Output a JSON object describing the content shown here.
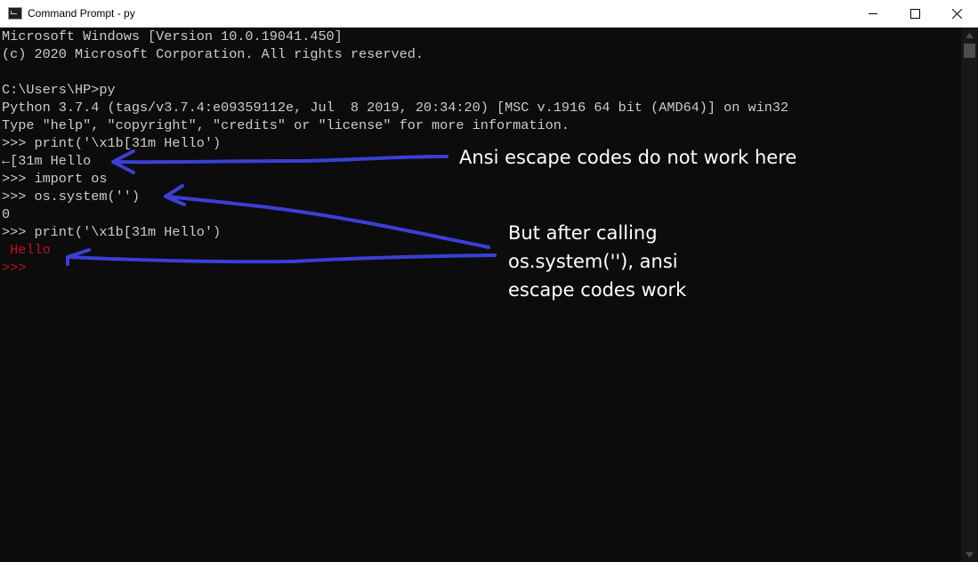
{
  "window": {
    "title": "Command Prompt - py",
    "icon": "cmd-icon",
    "controls": [
      "minimize-icon",
      "maximize-icon",
      "close-icon"
    ]
  },
  "console": {
    "lines": [
      "Microsoft Windows [Version 10.0.19041.450]",
      "(c) 2020 Microsoft Corporation. All rights reserved.",
      "",
      "C:\\Users\\HP>py",
      "Python 3.7.4 (tags/v3.7.4:e09359112e, Jul  8 2019, 20:34:20) [MSC v.1916 64 bit (AMD64)] on win32",
      "Type \"help\", \"copyright\", \"credits\" or \"license\" for more information.",
      ">>> print('\\x1b[31m Hello')",
      "←[31m Hello",
      ">>> import os",
      ">>> os.system('')",
      "0",
      ">>> print('\\x1b[31m Hello')",
      " Hello",
      ">>>"
    ],
    "colors": {
      "background": "#0c0c0c",
      "text": "#cccccc",
      "red": "#c50f1f"
    }
  },
  "annotations": {
    "first": "Ansi escape codes do not work here",
    "second": [
      "But after calling",
      "os.system(''), ansi",
      "escape codes work"
    ],
    "arrow_color": "#3b3fd6"
  }
}
